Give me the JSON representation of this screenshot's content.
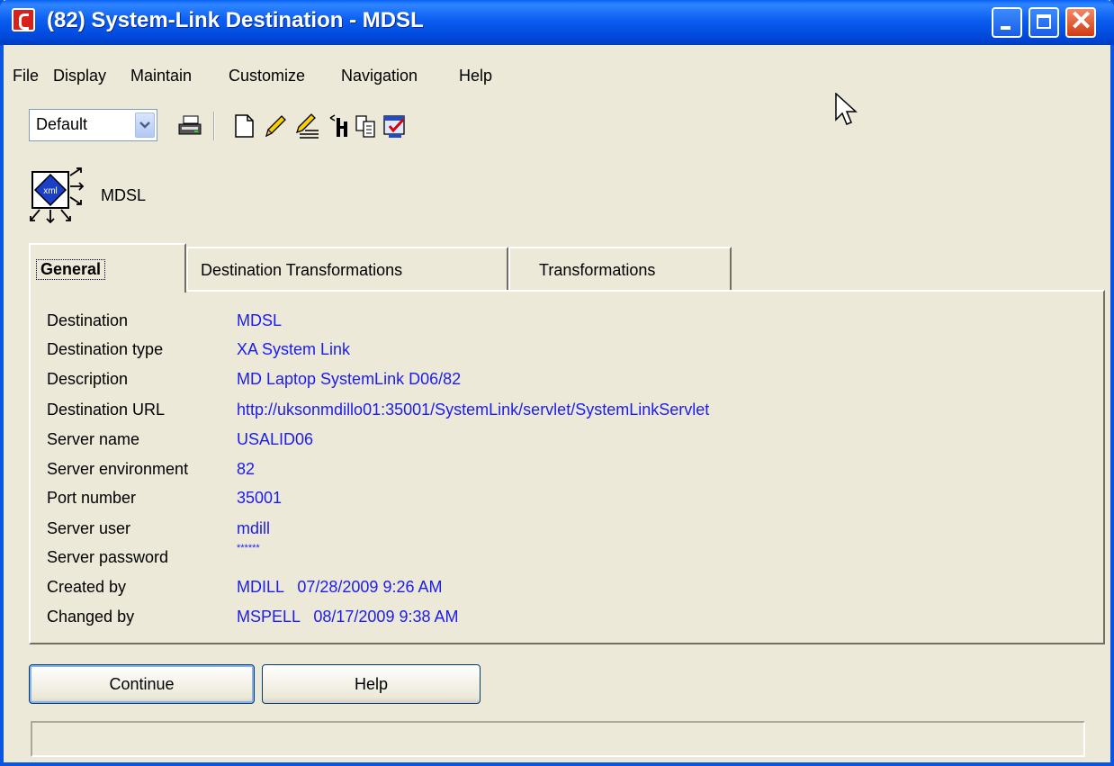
{
  "window": {
    "title": "(82) System-Link Destination - MDSL"
  },
  "menu": {
    "items": [
      "File",
      "Display",
      "Maintain",
      "Customize",
      "Navigation",
      "Help"
    ]
  },
  "toolbar": {
    "view_select": "Default",
    "icons": [
      "print-icon",
      "new-document-icon",
      "edit-pencil-icon",
      "edit-text-icon",
      "tools-icon",
      "copy-icon",
      "select-checklist-icon"
    ]
  },
  "header": {
    "label": "MDSL",
    "icon": "xml-destination-icon"
  },
  "tabs": [
    {
      "label": "General",
      "active": true
    },
    {
      "label": "Destination Transformations",
      "active": false
    },
    {
      "label": "Transformations",
      "active": false
    }
  ],
  "fields": [
    {
      "label": "Destination",
      "value": "MDSL"
    },
    {
      "label": "Destination type",
      "value": "XA System Link"
    },
    {
      "label": "Description",
      "value": "MD Laptop SystemLink D06/82"
    },
    {
      "label": "Destination URL",
      "value": "http://uksonmdillo01:35001/SystemLink/servlet/SystemLinkServlet"
    },
    {
      "label": "Server name",
      "value": "USALID06"
    },
    {
      "label": "Server environment",
      "value": "82"
    },
    {
      "label": "Port number",
      "value": "35001"
    },
    {
      "label": "Server user",
      "value": "mdill"
    },
    {
      "label": "Server password",
      "value": "******"
    },
    {
      "label": "Created by",
      "value": "MDILL   07/28/2009 9:26 AM"
    },
    {
      "label": "Changed by",
      "value": "MSPELL   08/17/2009 9:38 AM"
    }
  ],
  "buttons": {
    "continue": "Continue",
    "help": "Help"
  },
  "colors": {
    "titlebar": "#0b5df0",
    "field_value": "#1c1cf0",
    "window_bg": "#ece9d8"
  }
}
